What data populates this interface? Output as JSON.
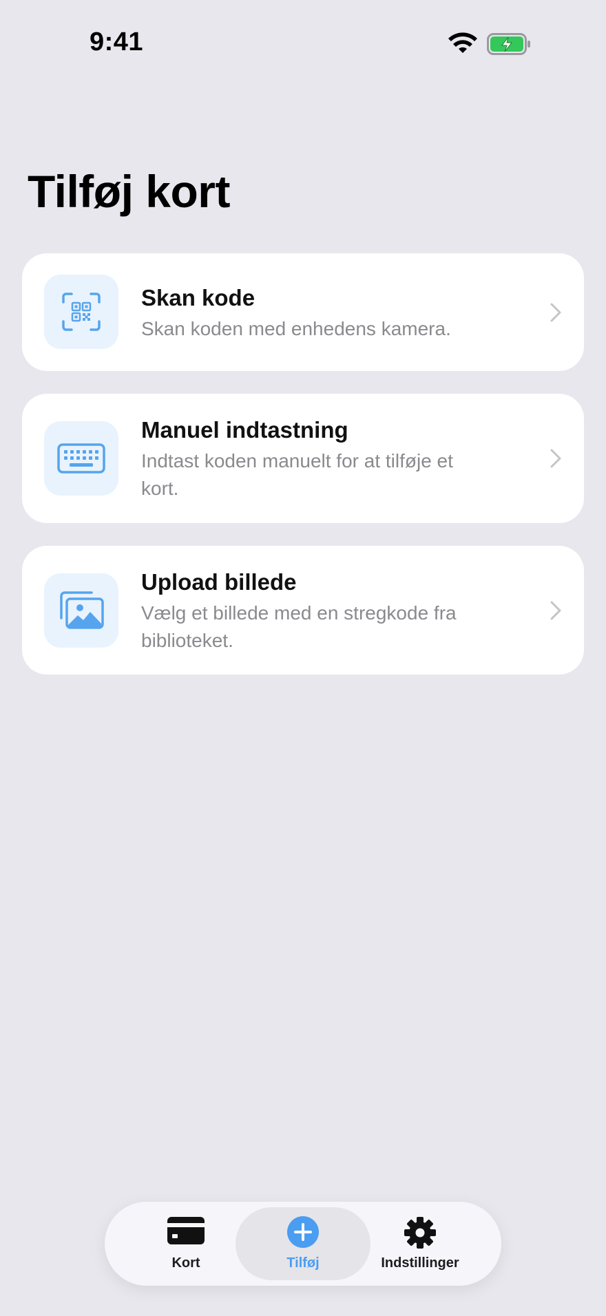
{
  "status_bar": {
    "time": "9:41"
  },
  "page": {
    "title": "Tilføj kort"
  },
  "options": [
    {
      "icon": "qr-scan-icon",
      "title": "Skan kode",
      "description": "Skan koden med enhedens kamera."
    },
    {
      "icon": "keyboard-icon",
      "title": "Manuel indtastning",
      "description": "Indtast koden manuelt for at tilføje et kort."
    },
    {
      "icon": "photo-library-icon",
      "title": "Upload billede",
      "description": "Vælg et billede med en stregkode fra biblioteket."
    }
  ],
  "tab_bar": {
    "items": [
      {
        "label": "Kort",
        "icon": "card-icon",
        "active": false
      },
      {
        "label": "Tilføj",
        "icon": "plus-circle-icon",
        "active": true
      },
      {
        "label": "Indstillinger",
        "icon": "gear-icon",
        "active": false
      }
    ]
  },
  "colors": {
    "background": "#e8e7ed",
    "accent": "#4a9df1",
    "icon_tile": "#e9f3fd",
    "battery_green": "#34c759"
  }
}
